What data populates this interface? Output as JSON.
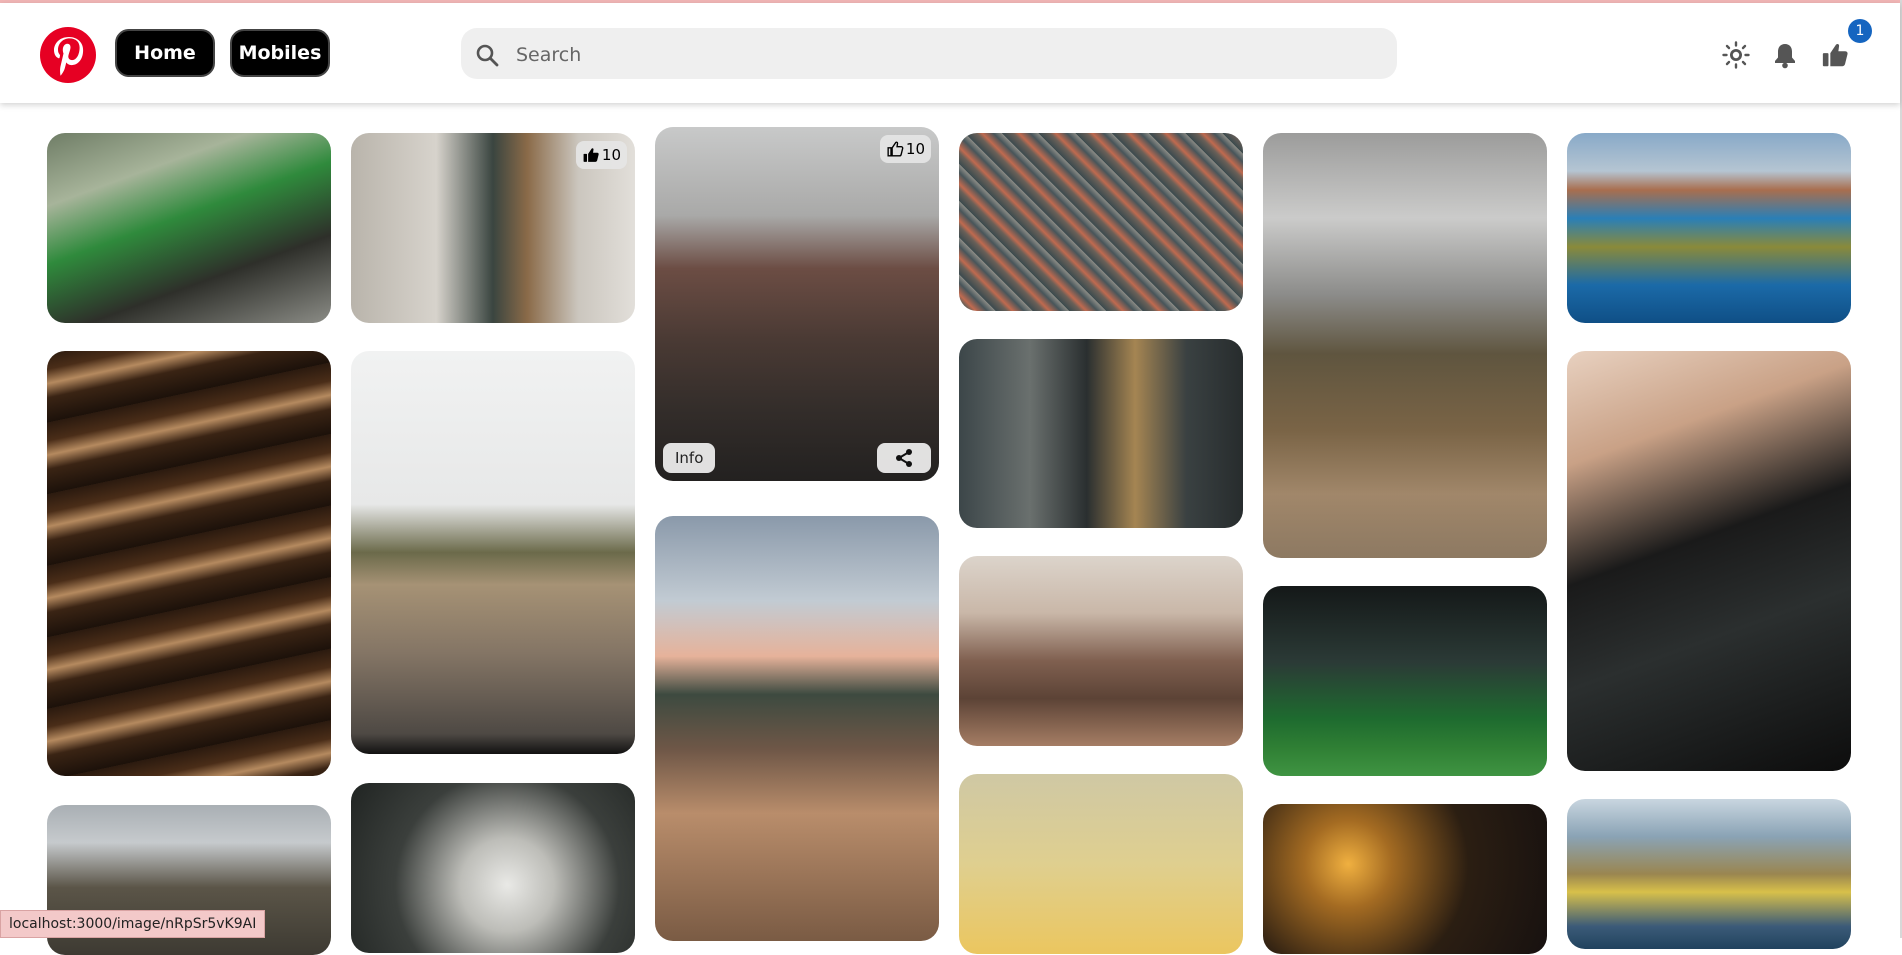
{
  "header": {
    "logo_alt": "Pinterest logo",
    "nav": [
      {
        "label": "Home"
      },
      {
        "label": "Mobiles"
      }
    ],
    "search": {
      "placeholder": "Search",
      "value": ""
    },
    "icons": [
      "sun-icon",
      "bell-icon",
      "thumbs-up-icon"
    ],
    "like_badge": "1"
  },
  "pins": {
    "p2_likes": "10",
    "p3_likes": "10",
    "p3_info": "Info"
  },
  "status_bar": {
    "url": "localhost:3000/image/nRpSr5vK9AI"
  },
  "colors": {
    "brand": "#e60023",
    "pill_bg": "#000000",
    "badge": "#1565c0",
    "search_bg": "#efefef"
  }
}
